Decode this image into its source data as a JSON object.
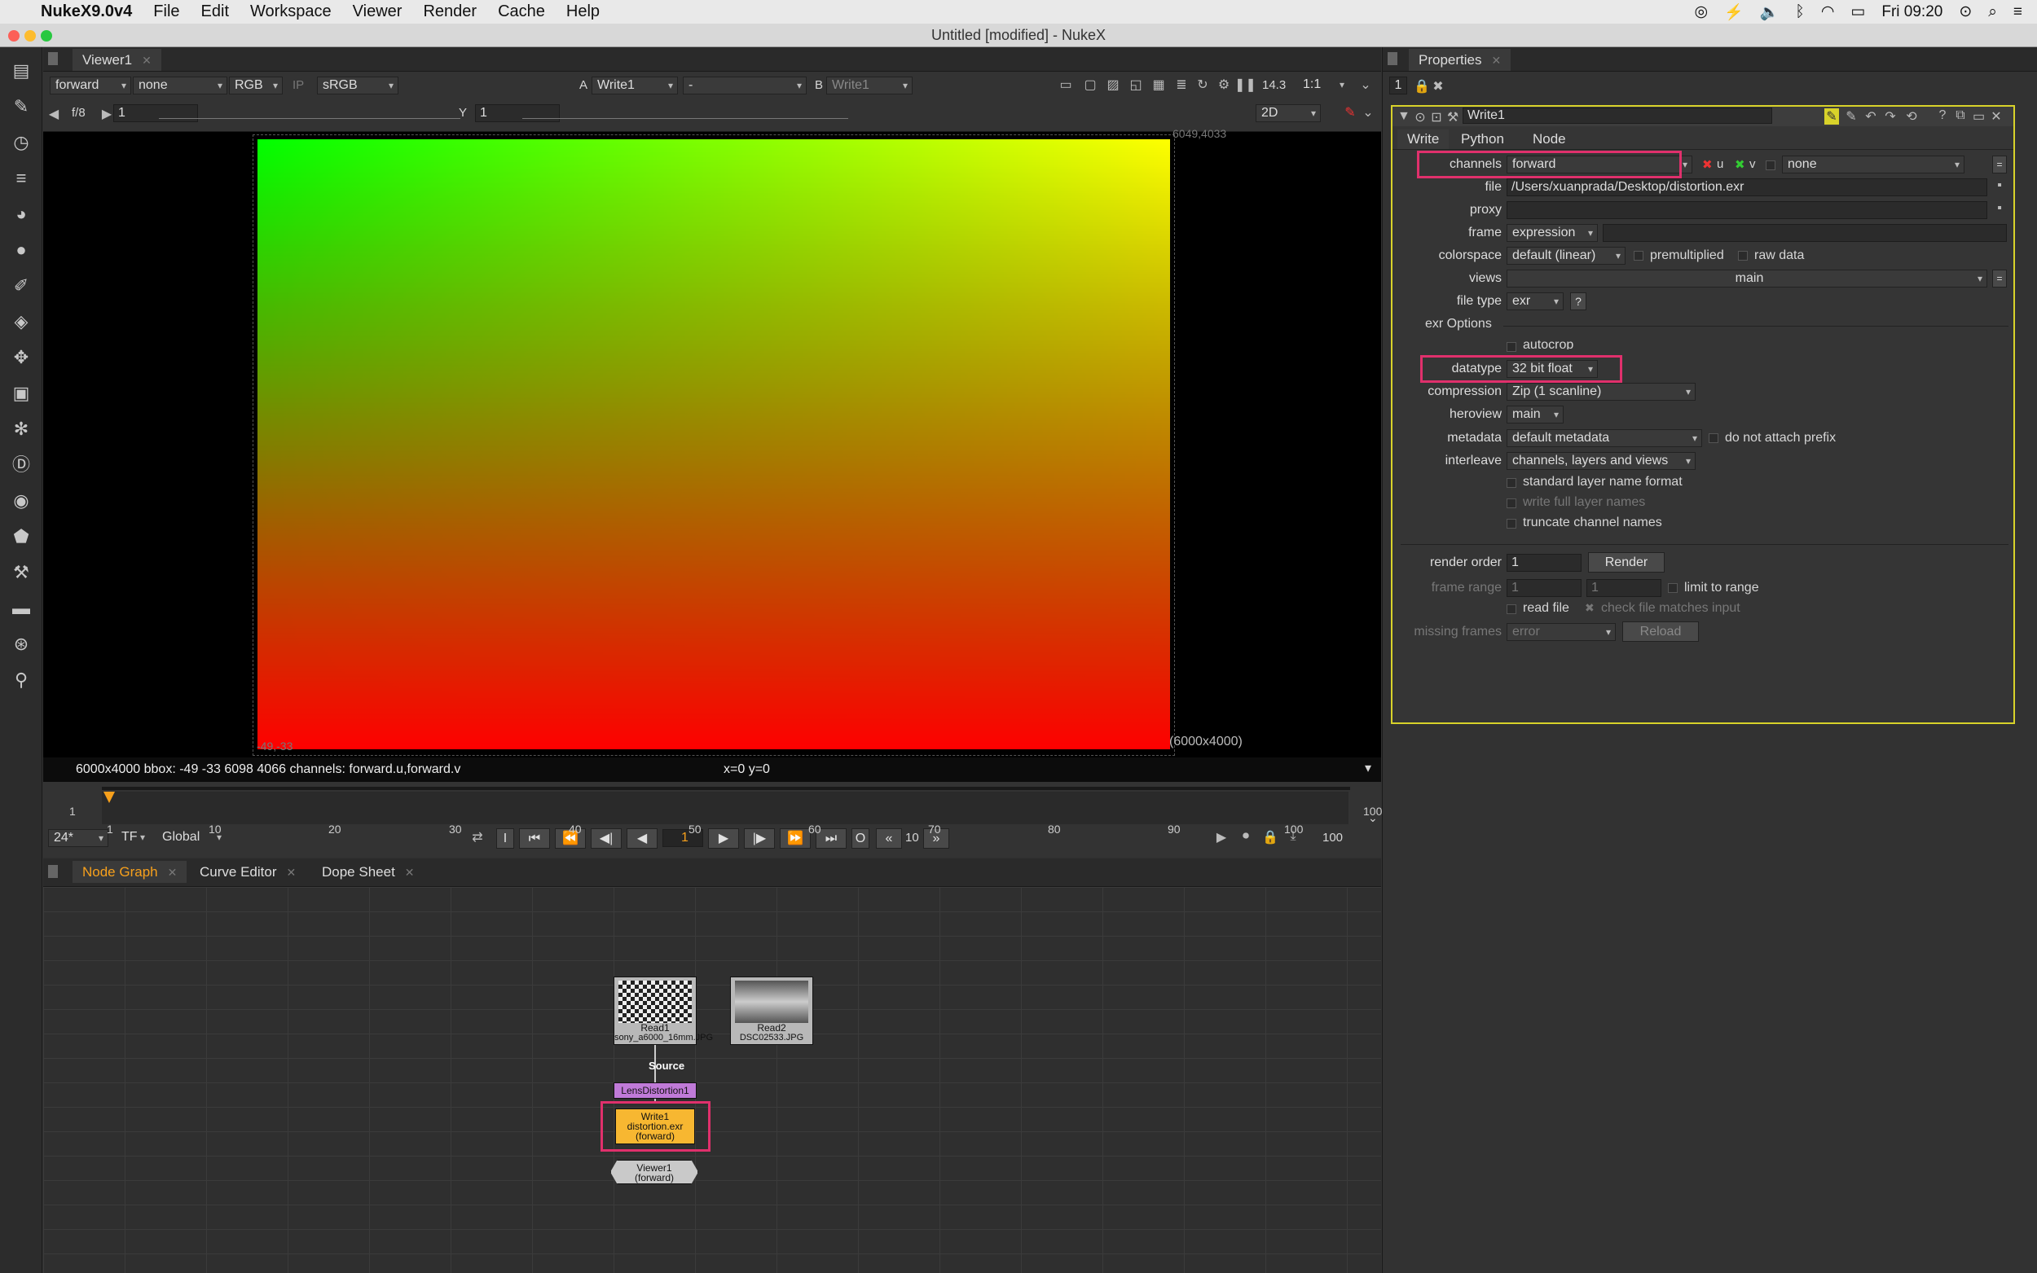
{
  "menubar": {
    "app": "NukeX9.0v4",
    "items": [
      "File",
      "Edit",
      "Workspace",
      "Viewer",
      "Render",
      "Cache",
      "Help"
    ],
    "clock": "Fri 09:20"
  },
  "window": {
    "title": "Untitled [modified] - NukeX"
  },
  "viewer": {
    "tab": "Viewer1",
    "layer": "forward",
    "alpha_layer": "none",
    "display_channels": "RGB",
    "ip": "IP",
    "lut": "sRGB",
    "input_a_label": "A",
    "input_a": "Write1",
    "input_a_op": "-",
    "input_b_label": "B",
    "input_b": "Write1",
    "gain_label": "f/8",
    "gain_value": "1",
    "gamma_label": "Y",
    "gamma_value": "1",
    "zoom": "14.3",
    "ratio": "1:1",
    "mode": "2D",
    "corner_tr": "6049,4033",
    "corner_bl": "-49,-33",
    "format": "(6000x4000)",
    "info": "6000x4000  bbox: -49 -33 6098 4066 channels: forward.u,forward.v",
    "coords": "x=0 y=0"
  },
  "timeline": {
    "start": "1",
    "end": "100",
    "current": "1",
    "fps": "24*",
    "tf": "TF",
    "range_mode": "Global",
    "step": "10",
    "end_field": "100",
    "ticks": [
      "1",
      "10",
      "20",
      "30",
      "40",
      "50",
      "60",
      "70",
      "80",
      "90",
      "100"
    ],
    "in_label": "I",
    "out_label": "O"
  },
  "graph": {
    "tabs": [
      "Node Graph",
      "Curve Editor",
      "Dope Sheet"
    ],
    "nodes": {
      "read1_name": "Read1",
      "read1_file": "sony_a6000_16mm.JPG",
      "read2_name": "Read2",
      "read2_file": "DSC02533.JPG",
      "source": "Source",
      "lens": "LensDistortion1",
      "write_name": "Write1",
      "write_file": "distortion.exr",
      "write_chan": "(forward)",
      "viewer_name": "Viewer1",
      "viewer_chan": "(forward)"
    }
  },
  "properties": {
    "tab": "Properties",
    "count": "1",
    "node_name": "Write1",
    "subtabs": [
      "Write",
      "Python",
      "Node"
    ],
    "channels_label": "channels",
    "channels": "forward",
    "chan_u": "u",
    "chan_v": "v",
    "chan_extra": "none",
    "file_label": "file",
    "file": "/Users/xuanprada/Desktop/distortion.exr",
    "proxy_label": "proxy",
    "frame_label": "frame",
    "frame": "expression",
    "colorspace_label": "colorspace",
    "colorspace": "default (linear)",
    "premultiplied": "premultiplied",
    "raw_data": "raw data",
    "views_label": "views",
    "views": "main",
    "filetype_label": "file type",
    "filetype": "exr",
    "help": "?",
    "exr_options": "exr Options",
    "autocrop": "autocrop",
    "datatype_label": "datatype",
    "datatype": "32 bit float",
    "compression_label": "compression",
    "compression": "Zip (1 scanline)",
    "heroview_label": "heroview",
    "heroview": "main",
    "metadata_label": "metadata",
    "metadata": "default metadata",
    "no_prefix": "do not attach prefix",
    "interleave_label": "interleave",
    "interleave": "channels, layers and views",
    "std_layer": "standard layer name format",
    "full_layer": "write full layer names",
    "truncate": "truncate channel names",
    "render_order_label": "render order",
    "render_order": "1",
    "render_btn": "Render",
    "frame_range_label": "frame range",
    "range_start": "1",
    "range_end": "1",
    "limit": "limit to range",
    "read_file": "read file",
    "check_file": "check file matches input",
    "missing_label": "missing frames",
    "missing": "error",
    "reload_btn": "Reload"
  }
}
